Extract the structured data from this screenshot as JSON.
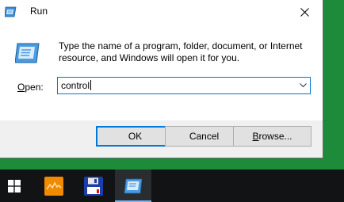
{
  "dialog": {
    "title": "Run",
    "prompt": "Type the name of a program, folder, document, or Internet resource, and Windows will open it for you.",
    "open_label_access": "O",
    "open_label_rest": "pen:",
    "input_value": "control",
    "buttons": {
      "ok": "OK",
      "cancel": "Cancel",
      "browse_access": "B",
      "browse_rest": "rowse..."
    }
  },
  "taskbar": {
    "items": [
      "windows-start-icon",
      "app-orange-icon",
      "floppy-disk-icon",
      "run-icon"
    ]
  },
  "colors": {
    "accent": "#0078d7",
    "desktop": "#1e8b3a",
    "taskbar": "#111315"
  }
}
